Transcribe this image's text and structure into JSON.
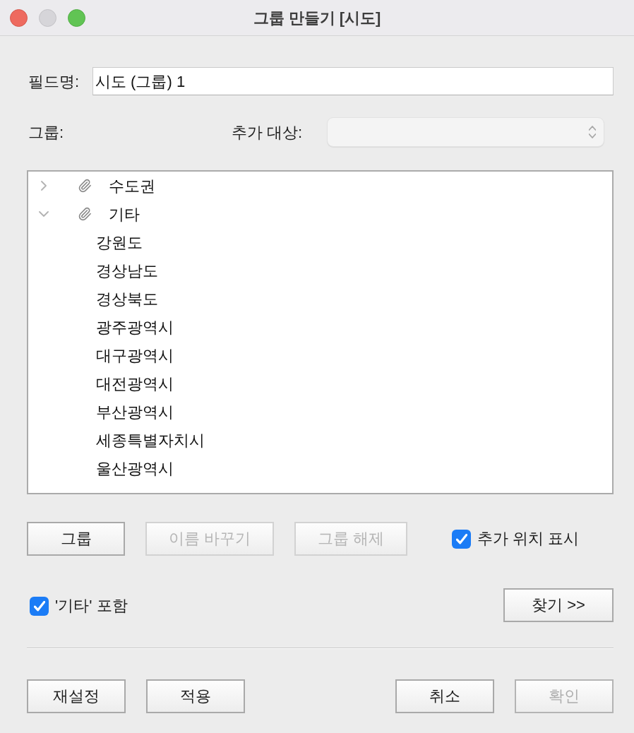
{
  "window": {
    "title": "그룹 만들기 [시도]"
  },
  "field_name": {
    "label": "필드명:",
    "value": "시도 (그룹) 1"
  },
  "group_label": "그룹:",
  "add_to": {
    "label": "추가 대상:"
  },
  "tree": [
    {
      "label": "수도권",
      "expanded": false
    },
    {
      "label": "기타",
      "expanded": true,
      "children": [
        {
          "label": "강원도"
        },
        {
          "label": "경상남도"
        },
        {
          "label": "경상북도"
        },
        {
          "label": "광주광역시"
        },
        {
          "label": "대구광역시"
        },
        {
          "label": "대전광역시"
        },
        {
          "label": "부산광역시"
        },
        {
          "label": "세종특별자치시"
        },
        {
          "label": "울산광역시"
        }
      ]
    }
  ],
  "buttons": [
    {
      "label": "그룹",
      "disabled": false
    },
    {
      "label": "이름 바꾸기",
      "disabled": true
    },
    {
      "label": "그룹 해제",
      "disabled": true
    }
  ],
  "show_add_location": {
    "label": "추가 위치 표시",
    "checked": true
  },
  "include_other": {
    "label": "'기타' 포함",
    "checked": true
  },
  "find_button": {
    "label": "찾기 >>"
  },
  "footer": {
    "left": [
      {
        "label": "재설정",
        "disabled": false
      },
      {
        "label": "적용",
        "disabled": false
      }
    ],
    "right": [
      {
        "label": "취소",
        "disabled": false
      },
      {
        "label": "확인",
        "disabled": true
      }
    ]
  }
}
